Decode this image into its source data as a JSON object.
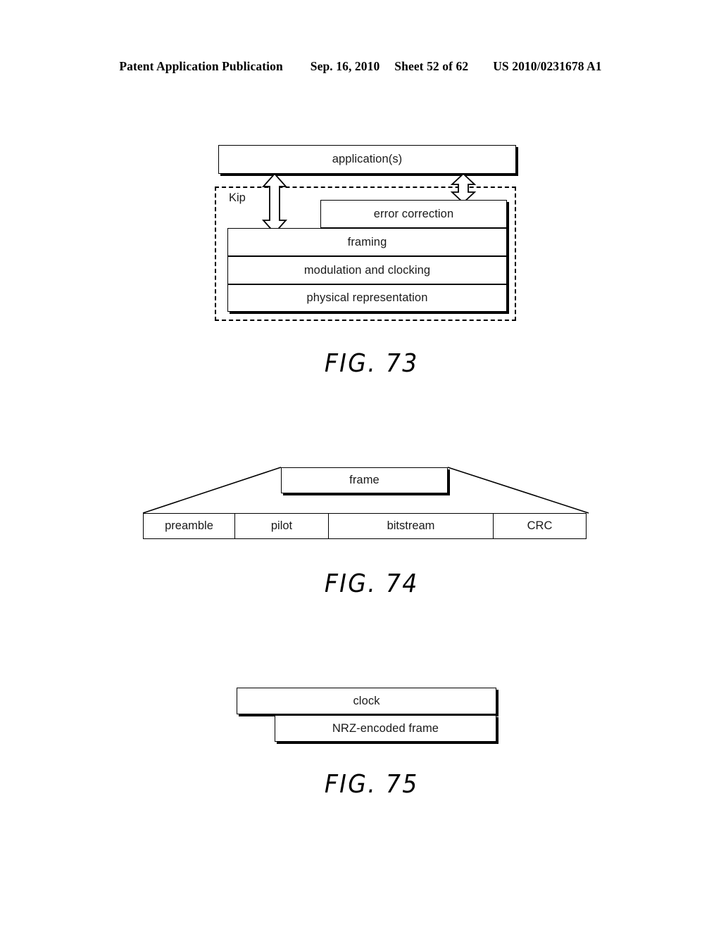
{
  "header": {
    "publication": "Patent Application Publication",
    "date": "Sep. 16, 2010",
    "sheet": "Sheet 52 of 62",
    "patent_number": "US 2010/0231678 A1"
  },
  "figures": [
    {
      "caption": "FIG. 73",
      "application_box": "application(s)",
      "region_label": "Kip",
      "stack": [
        "error correction",
        "framing",
        "modulation and clocking",
        "physical representation"
      ],
      "arrows": [
        "double-headed-vertical-arrow",
        "double-headed-vertical-arrow"
      ]
    },
    {
      "caption": "FIG. 74",
      "frame_box": "frame",
      "segments": [
        "preamble",
        "pilot",
        "bitstream",
        "CRC"
      ]
    },
    {
      "caption": "FIG. 75",
      "boxes": [
        "clock",
        "NRZ-encoded frame"
      ]
    }
  ],
  "colors": {
    "ink": "#000000",
    "paper": "#ffffff",
    "text": "#1a1a1a"
  }
}
